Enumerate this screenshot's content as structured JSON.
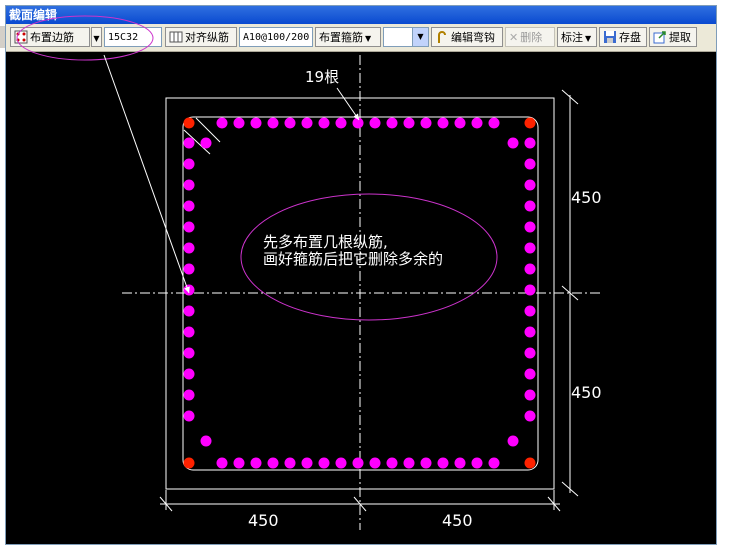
{
  "window": {
    "title": "截面编辑"
  },
  "toolbar": {
    "place_side_rebar": "布置边筋",
    "side_rebar_spec": "15C32",
    "align_long_rebar": "对齐纵筋",
    "stirrup_spec": "A10@100/200",
    "place_stirrup": "布置箍筋",
    "stirrup_combo_value": "",
    "edit_hook": "编辑弯钩",
    "delete": "删除",
    "annotate": "标注",
    "save": "存盘",
    "extract": "提取"
  },
  "drawing": {
    "count_label": "19根",
    "note_line1": "先多布置几根纵筋,",
    "note_line2": "画好箍筋后把它删除多余的",
    "dim_right_top": "450",
    "dim_right_bottom": "450",
    "dim_bottom_left": "450",
    "dim_bottom_right": "450"
  },
  "colors": {
    "rebar": "#ff00ff",
    "corner_rebar": "#ff2200",
    "annotation": "#cc33cc",
    "line": "#ffffff"
  }
}
